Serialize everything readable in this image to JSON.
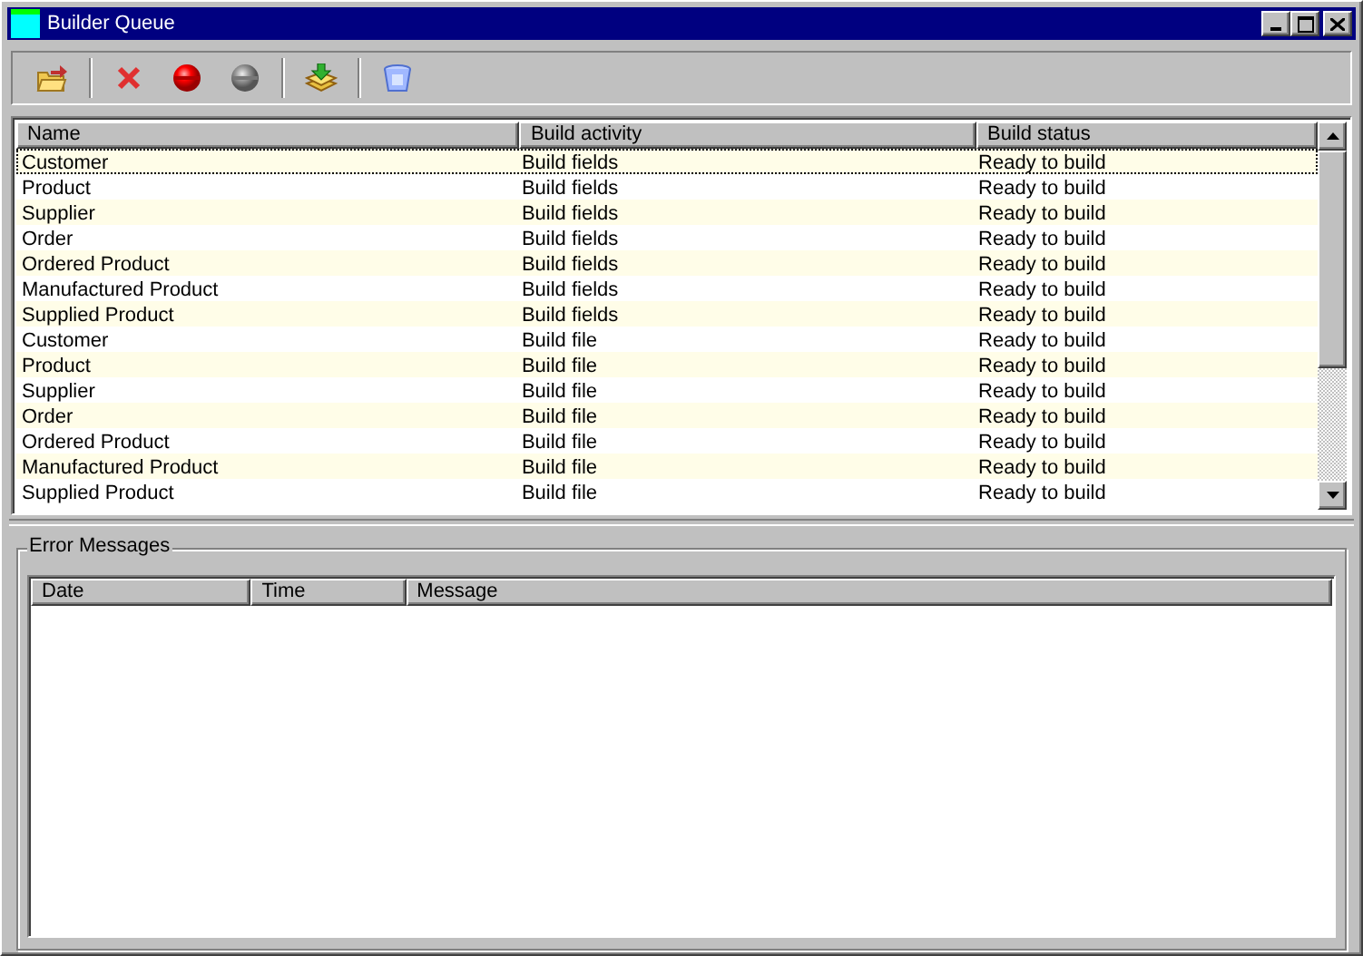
{
  "window": {
    "title": "Builder Queue"
  },
  "toolbar": [
    {
      "kind": "open"
    },
    {
      "kind": "separator"
    },
    {
      "kind": "delete"
    },
    {
      "kind": "stop"
    },
    {
      "kind": "pause",
      "disabled": true
    },
    {
      "kind": "separator"
    },
    {
      "kind": "build"
    },
    {
      "kind": "separator"
    },
    {
      "kind": "clear"
    }
  ],
  "queue": {
    "columns": [
      "Name",
      "Build activity",
      "Build status"
    ],
    "rows": [
      {
        "cells": [
          "Customer",
          "Build fields",
          "Ready to build"
        ],
        "selected": true
      },
      {
        "cells": [
          "Product",
          "Build fields",
          "Ready to build"
        ],
        "selected": false
      },
      {
        "cells": [
          "Supplier",
          "Build fields",
          "Ready to build"
        ],
        "selected": false
      },
      {
        "cells": [
          "Order",
          "Build fields",
          "Ready to build"
        ],
        "selected": false
      },
      {
        "cells": [
          "Ordered Product",
          "Build fields",
          "Ready to build"
        ],
        "selected": false
      },
      {
        "cells": [
          "Manufactured Product",
          "Build fields",
          "Ready to build"
        ],
        "selected": false
      },
      {
        "cells": [
          "Supplied Product",
          "Build fields",
          "Ready to build"
        ],
        "selected": false
      },
      {
        "cells": [
          "Customer",
          "Build file",
          "Ready to build"
        ],
        "selected": false
      },
      {
        "cells": [
          "Product",
          "Build file",
          "Ready to build"
        ],
        "selected": false
      },
      {
        "cells": [
          "Supplier",
          "Build file",
          "Ready to build"
        ],
        "selected": false
      },
      {
        "cells": [
          "Order",
          "Build file",
          "Ready to build"
        ],
        "selected": false
      },
      {
        "cells": [
          "Ordered Product",
          "Build file",
          "Ready to build"
        ],
        "selected": false
      },
      {
        "cells": [
          "Manufactured Product",
          "Build file",
          "Ready to build"
        ],
        "selected": false
      },
      {
        "cells": [
          "Supplied Product",
          "Build file",
          "Ready to build"
        ],
        "selected": false
      }
    ]
  },
  "error_messages": {
    "title": "Error Messages",
    "columns": [
      "Date",
      "Time",
      "Message"
    ]
  }
}
